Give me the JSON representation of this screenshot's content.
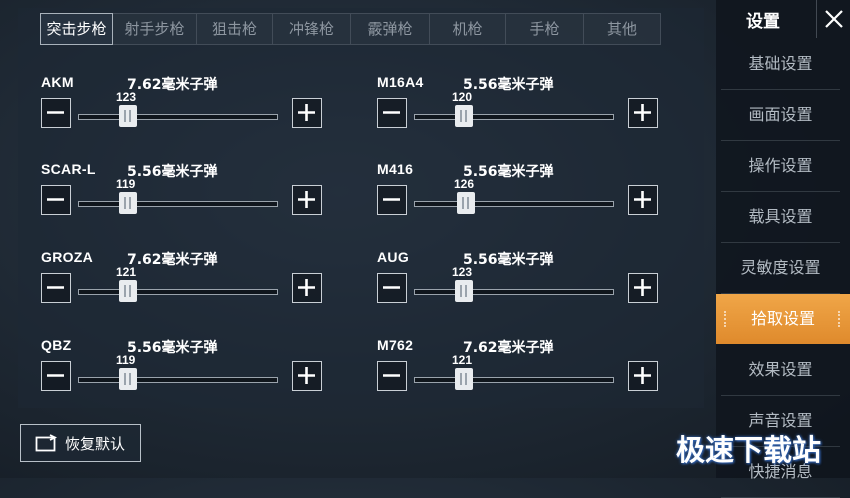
{
  "tabs": [
    {
      "label": "突击步枪",
      "active": true
    },
    {
      "label": "射手步枪",
      "active": false
    },
    {
      "label": "狙击枪",
      "active": false
    },
    {
      "label": "冲锋枪",
      "active": false
    },
    {
      "label": "霰弹枪",
      "active": false
    },
    {
      "label": "机枪",
      "active": false
    },
    {
      "label": "手枪",
      "active": false
    },
    {
      "label": "其他",
      "active": false
    }
  ],
  "weapons": [
    {
      "name": "AKM",
      "ammo": "7.62毫米子弹",
      "value": "123",
      "level": 0.25
    },
    {
      "name": "M16A4",
      "ammo": "5.56毫米子弹",
      "value": "120",
      "level": 0.25
    },
    {
      "name": "SCAR-L",
      "ammo": "5.56毫米子弹",
      "value": "119",
      "level": 0.25
    },
    {
      "name": "M416",
      "ammo": "5.56毫米子弹",
      "value": "126",
      "level": 0.26
    },
    {
      "name": "GROZA",
      "ammo": "7.62毫米子弹",
      "value": "121",
      "level": 0.25
    },
    {
      "name": "AUG",
      "ammo": "5.56毫米子弹",
      "value": "123",
      "level": 0.25
    },
    {
      "name": "QBZ",
      "ammo": "5.56毫米子弹",
      "value": "119",
      "level": 0.25
    },
    {
      "name": "M762",
      "ammo": "7.62毫米子弹",
      "value": "121",
      "level": 0.25
    }
  ],
  "restore_label": "恢复默认",
  "sidebar": {
    "title": "设置",
    "items": [
      {
        "label": "基础设置",
        "active": false
      },
      {
        "label": "画面设置",
        "active": false
      },
      {
        "label": "操作设置",
        "active": false
      },
      {
        "label": "载具设置",
        "active": false
      },
      {
        "label": "灵敏度设置",
        "active": false
      },
      {
        "label": "拾取设置",
        "active": true
      },
      {
        "label": "效果设置",
        "active": false
      },
      {
        "label": "声音设置",
        "active": false
      },
      {
        "label": "快捷消息",
        "active": false
      }
    ]
  },
  "watermark": "极速下载站",
  "colors": {
    "accent": "#e8973a",
    "panel": "#1e2834"
  }
}
